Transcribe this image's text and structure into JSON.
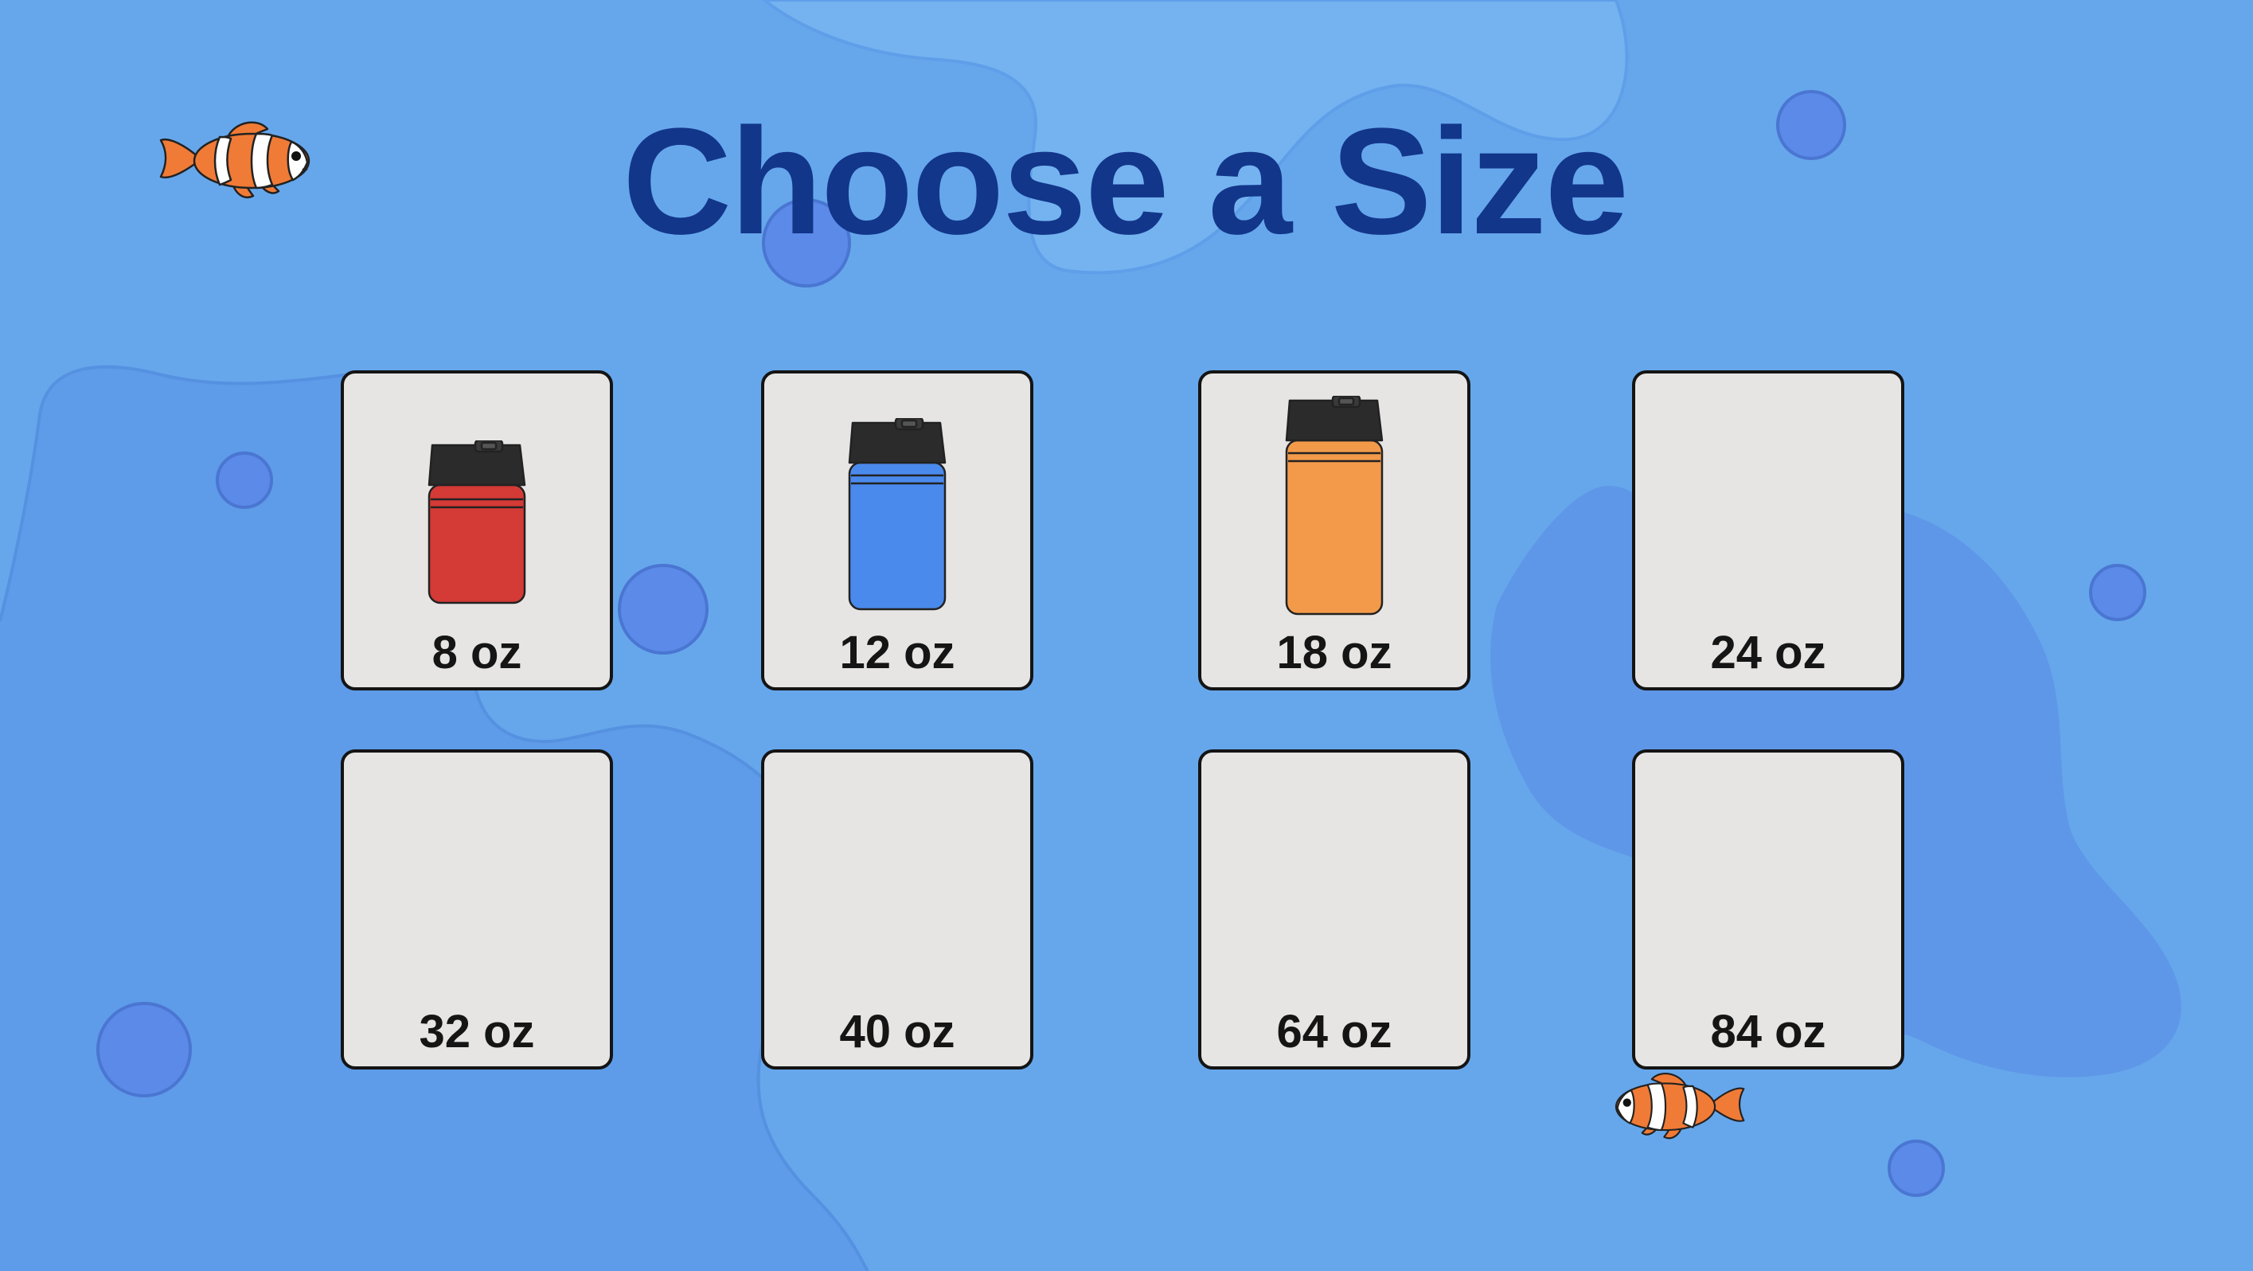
{
  "page": {
    "title": "Choose a Size"
  },
  "sizes": [
    {
      "label": "8 oz",
      "bottle_color": "#d43a36",
      "has_bottle": true
    },
    {
      "label": "12 oz",
      "bottle_color": "#4a8aec",
      "has_bottle": true
    },
    {
      "label": "18 oz",
      "bottle_color": "#f39a4a",
      "has_bottle": true
    },
    {
      "label": "24 oz",
      "has_bottle": false
    },
    {
      "label": "32 oz",
      "has_bottle": false
    },
    {
      "label": "40 oz",
      "has_bottle": false
    },
    {
      "label": "64 oz",
      "has_bottle": false
    },
    {
      "label": "84 oz",
      "has_bottle": false
    }
  ],
  "colors": {
    "background": "#66a7ec",
    "title": "#12368a",
    "card": "#e6e5e4",
    "card_border": "#141414",
    "bubble": "#5b8ae8"
  },
  "icons": {
    "decoration": [
      "clownfish-icon",
      "bubble-icon"
    ]
  }
}
